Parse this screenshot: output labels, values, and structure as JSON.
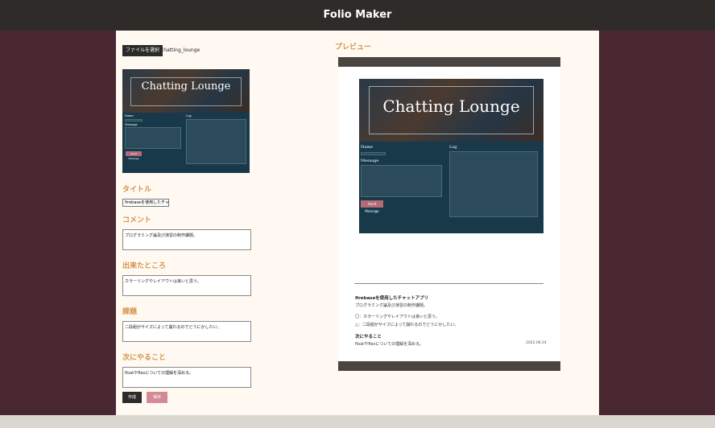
{
  "app": {
    "title": "Folio Maker"
  },
  "form": {
    "file_button": "ファイルを選択",
    "file_name": "chatting_lounge",
    "title_heading": "タイトル",
    "title_value": "firebaseを使用したチャ",
    "comment_heading": "コメント",
    "comment_value": "プログラミング論及び演習の制作課題。",
    "good_heading": "出来たところ",
    "good_value": "カラーリングやレイアウトは良いと思う。",
    "issue_heading": "課題",
    "issue_value": "二段組がサイズによって崩れるのでどうにかしたい。",
    "next_heading": "次にやること",
    "next_value": "floatやflexについての理解を深める。",
    "create_button": "作成",
    "save_button": "保存"
  },
  "thumbnail": {
    "hero_title": "Chatting Lounge",
    "name_label": "Name",
    "message_label": "Message",
    "log_label": "Log",
    "send_button": "Send Message"
  },
  "preview": {
    "heading": "プレビュー",
    "title": "firebaseを使用したチャットアプリ",
    "comment": "プログラミング論及び演習の制作課題。",
    "good_line": "〇：カラーリングやレイアウトは良いと思う。",
    "issue_line": "△：二段組がサイズによって崩れるのでどうにかしたい。",
    "next_heading": "次にやること",
    "next_text": "floatやflexについての理解を深める。",
    "date": "2022.06.24"
  }
}
